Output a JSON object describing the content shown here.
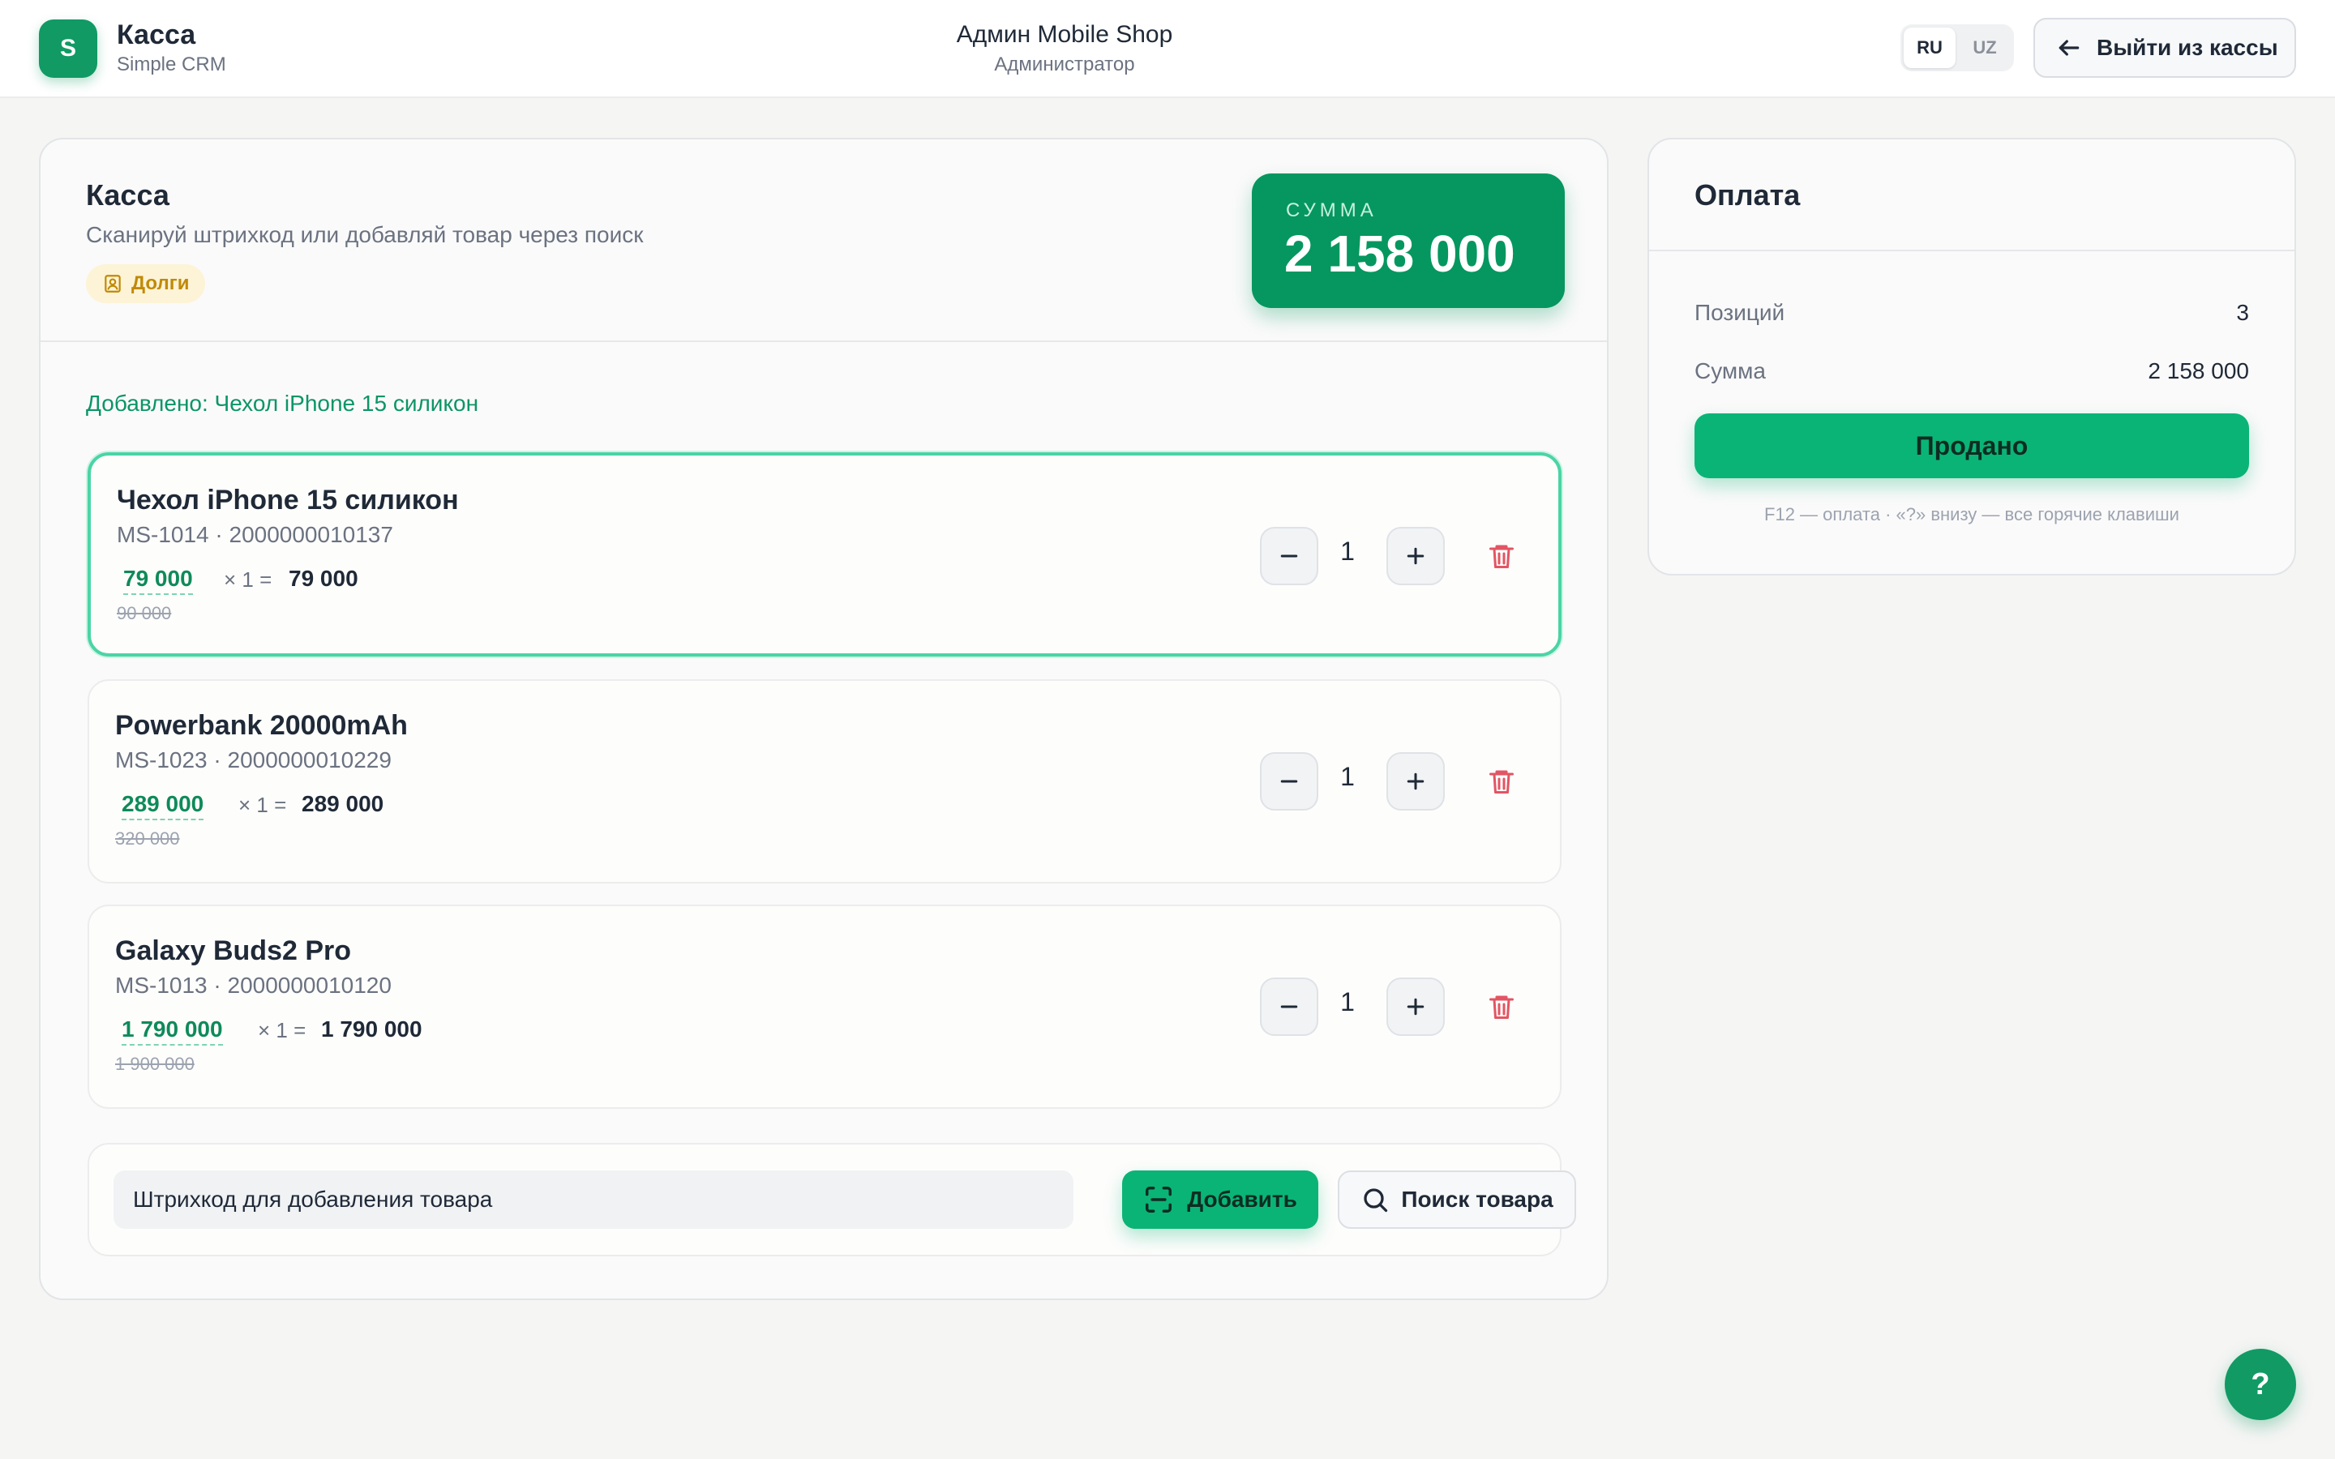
{
  "header": {
    "logo_letter": "S",
    "app_title": "Касса",
    "app_subtitle": "Simple CRM",
    "shop_name": "Админ Mobile Shop",
    "role": "Администратор",
    "languages": [
      "RU",
      "UZ"
    ],
    "active_language": "RU",
    "exit_label": "Выйти из кассы"
  },
  "cashier": {
    "title": "Касса",
    "subtitle": "Сканируй штрихкод или добавляй товар через поиск",
    "debt_label": "Долги",
    "sum_label": "СУММА",
    "sum_value": "2 158 000",
    "added_message": "Добавлено: Чехол iPhone 15 силикон"
  },
  "items": [
    {
      "name": "Чехол iPhone 15 силикон",
      "code": "MS-1014 · 2000000010137",
      "price": "79 000",
      "multiplier": "× 1 =",
      "total": "79 000",
      "old_price": "90 000",
      "qty": "1",
      "highlighted": true
    },
    {
      "name": "Powerbank 20000mAh",
      "code": "MS-1023 · 2000000010229",
      "price": "289 000",
      "multiplier": "× 1 =",
      "total": "289 000",
      "old_price": "320 000",
      "qty": "1",
      "highlighted": false
    },
    {
      "name": "Galaxy Buds2 Pro",
      "code": "MS-1013 · 2000000010120",
      "price": "1 790 000",
      "multiplier": "× 1 =",
      "total": "1 790 000",
      "old_price": "1 900 000",
      "qty": "1",
      "highlighted": false
    }
  ],
  "barcode": {
    "placeholder": "Штрихкод для добавления товара",
    "add_label": "Добавить",
    "search_label": "Поиск товара"
  },
  "payment": {
    "title": "Оплата",
    "positions_label": "Позиций",
    "positions_value": "3",
    "sum_label": "Сумма",
    "sum_value": "2 158 000",
    "sold_label": "Продано",
    "hint": "F12 — оплата · «?» внизу — все горячие клавиши"
  },
  "help_label": "?",
  "colors": {
    "brand_green": "#119a64",
    "accent_green": "#0ab477",
    "debt_yellow": "#c08a06",
    "delete_red": "#e25563"
  },
  "icons": [
    "arrow-left-icon",
    "debt-book-icon",
    "minus-icon",
    "plus-icon",
    "trash-icon",
    "barcode-scan-icon",
    "search-icon"
  ]
}
